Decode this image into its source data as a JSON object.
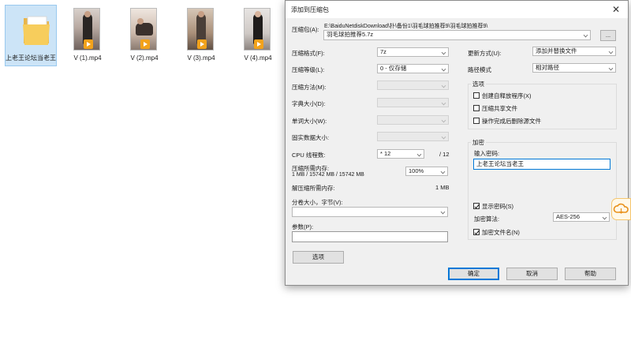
{
  "desktop": {
    "files": [
      {
        "name": "上老王论坛当老王",
        "type": "folder"
      },
      {
        "name": "V (1).mp4",
        "type": "video"
      },
      {
        "name": "V (2).mp4",
        "type": "video"
      },
      {
        "name": "V (3).mp4",
        "type": "video"
      },
      {
        "name": "V (4).mp4",
        "type": "video"
      }
    ]
  },
  "dialog": {
    "title": "添加到压缩包",
    "close": "✕",
    "archive_label": "压缩包(A):",
    "archive_path": "E:\\BaiduNetdiskDownload\\扑\\备份1\\羽毛球拍推荐9\\羽毛球拍推荐9\\",
    "archive_name": "羽毛球拍推荐5.7z",
    "browse": "...",
    "format_label": "压缩格式(F):",
    "format_value": "7z",
    "level_label": "压缩等级(L):",
    "level_value": "0 - 仅存储",
    "method_label": "压缩方法(M):",
    "dict_label": "字典大小(D):",
    "word_label": "单词大小(W):",
    "solid_label": "固实数据大小:",
    "cpu_label": "CPU 线程数:",
    "cpu_value": "* 12",
    "cpu_total": "/ 12",
    "mem_label": "压缩所需内存:",
    "mem_detail": "1 MB / 15742 MB / 15742 MB",
    "mem_value": "100%",
    "unmem_label": "解压缩所需内存:",
    "unmem_value": "1 MB",
    "split_label": "分卷大小，字节(V):",
    "params_label": "参数(P):",
    "options_button": "选项",
    "update_label": "更新方式(U):",
    "update_value": "添加并替换文件",
    "path_label": "路径模式",
    "path_value": "相对路径",
    "options_group": "选项",
    "opt_sfx": "创建自释放程序(X)",
    "opt_shared": "压缩共享文件",
    "opt_delete": "操作完成后删除源文件",
    "enc_group": "加密",
    "pwd_label": "输入密码:",
    "pwd_value": "上老王论坛当老王",
    "show_pwd": "显示密码(S)",
    "enc_method_label": "加密算法:",
    "enc_method_value": "AES-256",
    "enc_names": "加密文件名(N)",
    "ok": "确定",
    "cancel": "取消",
    "help": "帮助"
  },
  "side_icon": "cloud-icon"
}
